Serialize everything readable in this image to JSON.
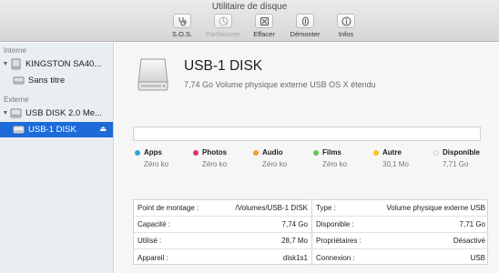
{
  "window": {
    "title": "Utilitaire de disque"
  },
  "toolbar": {
    "sos": "S.O.S.",
    "partition": "Partitionner",
    "erase": "Effacer",
    "unmount": "Démonter",
    "info": "Infos"
  },
  "sidebar": {
    "internal_label": "Interne",
    "external_label": "Externe",
    "items": [
      {
        "label": "KINGSTON SA40...",
        "icon": "hard-drive-icon"
      },
      {
        "label": "Sans titre",
        "icon": "volume-icon"
      },
      {
        "label": "USB DISK 2.0 Me...",
        "icon": "hard-drive-icon"
      },
      {
        "label": "USB-1 DISK",
        "icon": "volume-icon",
        "selected": true
      }
    ]
  },
  "disk": {
    "name": "USB-1 DISK",
    "description": "7,74 Go Volume physique externe USB OS X étendu"
  },
  "usage": {
    "fill_fraction": 0.005,
    "legend": [
      {
        "name": "Apps",
        "value": "Zéro ko",
        "color": "#29a8e0"
      },
      {
        "name": "Photos",
        "value": "Zéro ko",
        "color": "#e0306a"
      },
      {
        "name": "Audio",
        "value": "Zéro ko",
        "color": "#f49a2c"
      },
      {
        "name": "Films",
        "value": "Zéro ko",
        "color": "#5cc84a"
      },
      {
        "name": "Autre",
        "value": "30,1 Mo",
        "color": "#f3c51f"
      },
      {
        "name": "Disponible",
        "value": "7,71 Go",
        "color": "#f4f4f4"
      }
    ]
  },
  "info": {
    "left": [
      {
        "k": "Point de montage :",
        "v": "/Volumes/USB-1 DISK"
      },
      {
        "k": "Capacité :",
        "v": "7,74 Go"
      },
      {
        "k": "Utilisé :",
        "v": "28,7 Mo"
      },
      {
        "k": "Appareil :",
        "v": "disk1s1"
      }
    ],
    "right": [
      {
        "k": "Type :",
        "v": "Volume physique externe USB"
      },
      {
        "k": "Disponible :",
        "v": "7,71 Go"
      },
      {
        "k": "Propriétaires :",
        "v": "Désactivé"
      },
      {
        "k": "Connexion :",
        "v": "USB"
      }
    ]
  }
}
